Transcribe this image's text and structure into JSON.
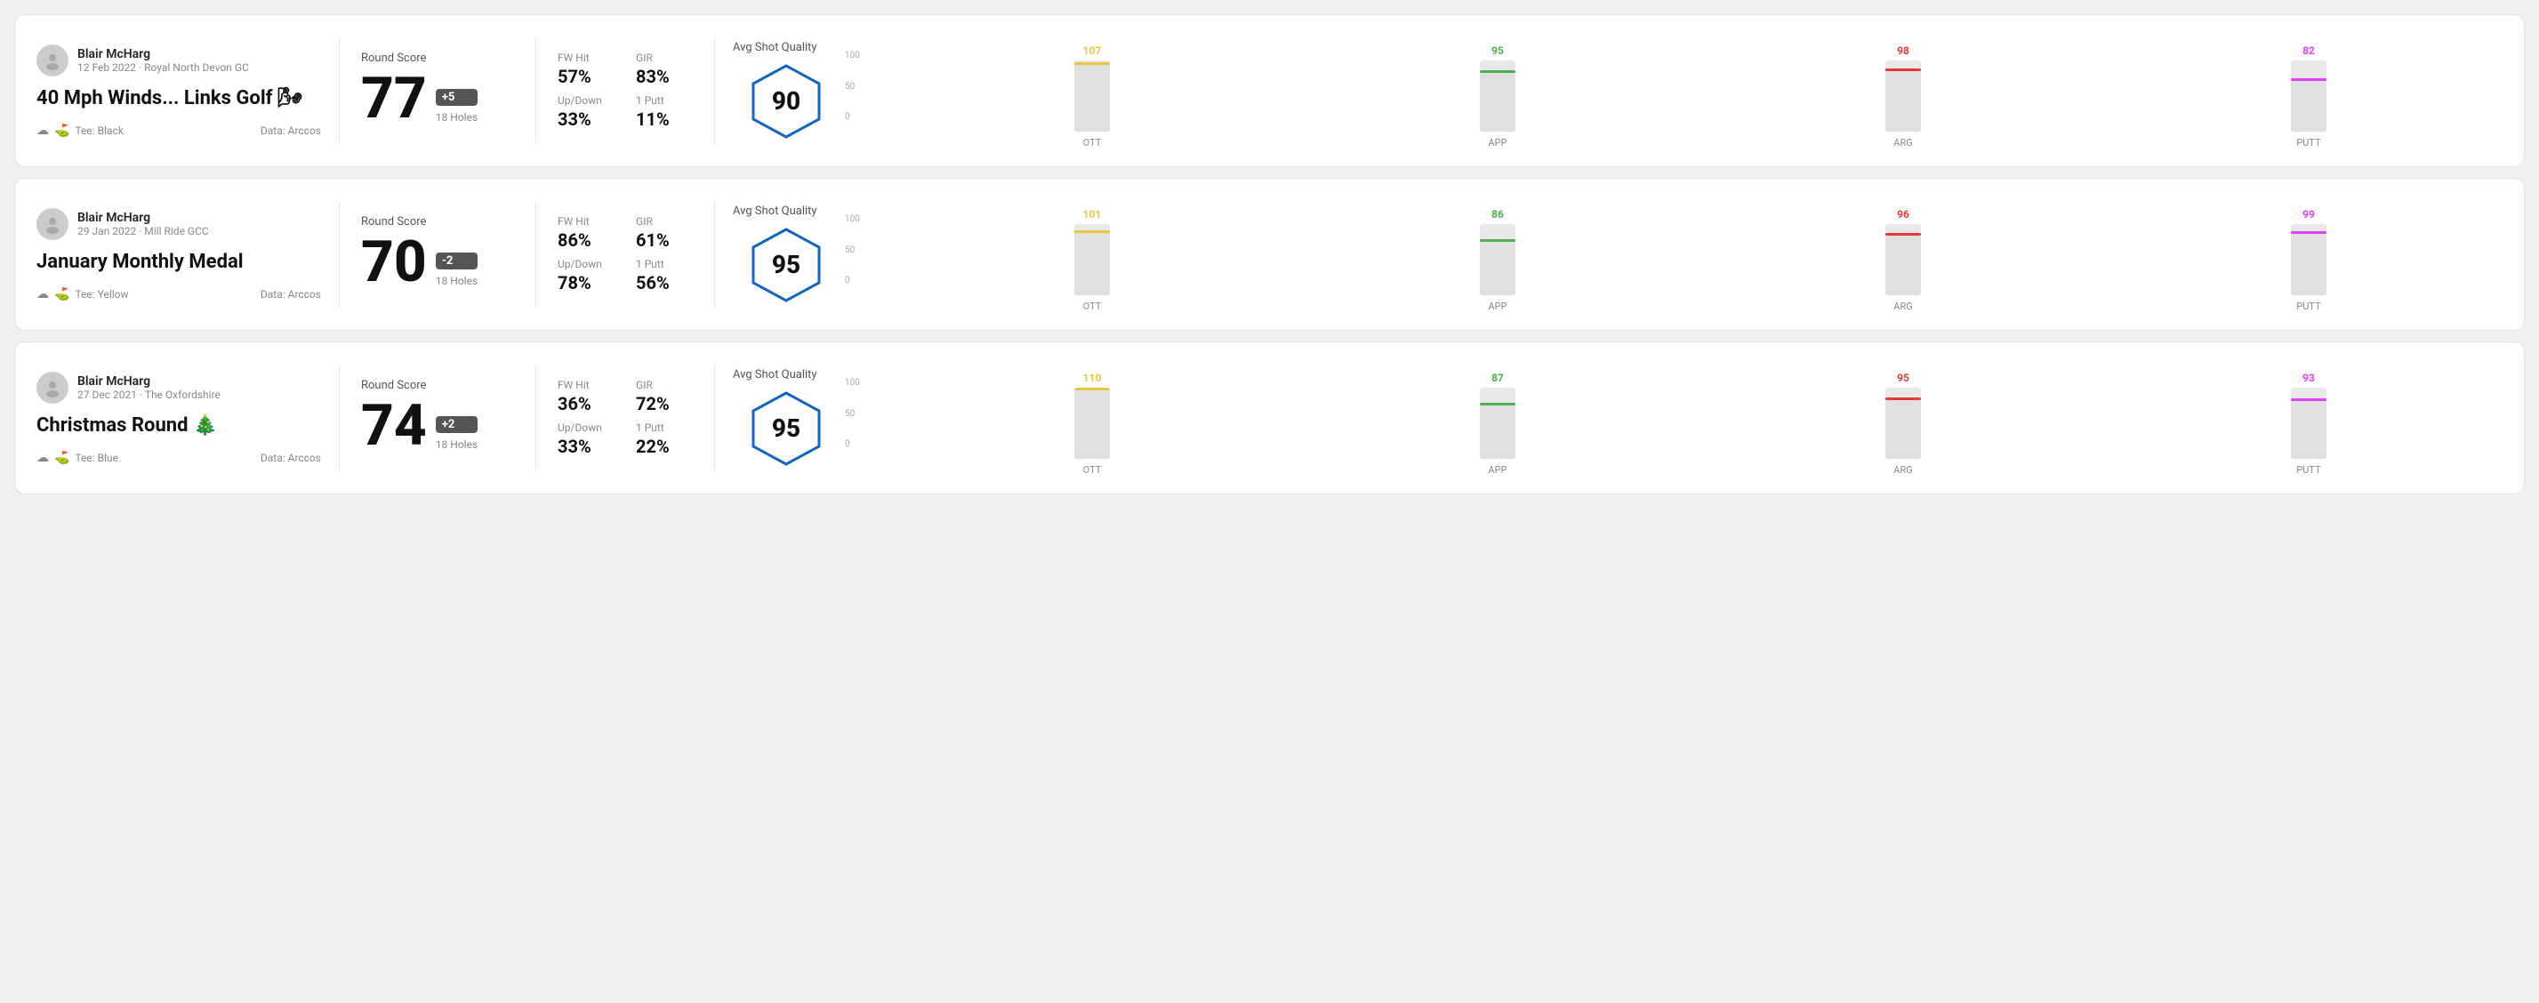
{
  "rounds": [
    {
      "id": "round-1",
      "user": {
        "name": "Blair McHarg",
        "date": "12 Feb 2022 · Royal North Devon GC"
      },
      "title": "40 Mph Winds... Links Golf 🌬",
      "tee": "Black",
      "data_source": "Data: Arccos",
      "round_score_label": "Round Score",
      "score": "77",
      "score_modifier": "+5",
      "holes": "18 Holes",
      "stats": {
        "fw_hit_label": "FW Hit",
        "fw_hit_value": "57%",
        "gir_label": "GIR",
        "gir_value": "83%",
        "updown_label": "Up/Down",
        "updown_value": "33%",
        "one_putt_label": "1 Putt",
        "one_putt_value": "11%"
      },
      "quality_label": "Avg Shot Quality",
      "quality_score": "90",
      "chart": {
        "bars": [
          {
            "label": "OTT",
            "value": 107,
            "color": "#e8c840"
          },
          {
            "label": "APP",
            "value": 95,
            "color": "#4caf50"
          },
          {
            "label": "ARG",
            "value": 98,
            "color": "#e53935"
          },
          {
            "label": "PUTT",
            "value": 82,
            "color": "#e040fb"
          }
        ],
        "max": 110,
        "y_labels": [
          "100",
          "50",
          "0"
        ]
      }
    },
    {
      "id": "round-2",
      "user": {
        "name": "Blair McHarg",
        "date": "29 Jan 2022 · Mill Ride GCC"
      },
      "title": "January Monthly Medal",
      "tee": "Yellow",
      "data_source": "Data: Arccos",
      "round_score_label": "Round Score",
      "score": "70",
      "score_modifier": "-2",
      "holes": "18 Holes",
      "stats": {
        "fw_hit_label": "FW Hit",
        "fw_hit_value": "86%",
        "gir_label": "GIR",
        "gir_value": "61%",
        "updown_label": "Up/Down",
        "updown_value": "78%",
        "one_putt_label": "1 Putt",
        "one_putt_value": "56%"
      },
      "quality_label": "Avg Shot Quality",
      "quality_score": "95",
      "chart": {
        "bars": [
          {
            "label": "OTT",
            "value": 101,
            "color": "#e8c840"
          },
          {
            "label": "APP",
            "value": 86,
            "color": "#4caf50"
          },
          {
            "label": "ARG",
            "value": 96,
            "color": "#e53935"
          },
          {
            "label": "PUTT",
            "value": 99,
            "color": "#e040fb"
          }
        ],
        "max": 110,
        "y_labels": [
          "100",
          "50",
          "0"
        ]
      }
    },
    {
      "id": "round-3",
      "user": {
        "name": "Blair McHarg",
        "date": "27 Dec 2021 · The Oxfordshire"
      },
      "title": "Christmas Round 🎄",
      "tee": "Blue",
      "data_source": "Data: Arccos",
      "round_score_label": "Round Score",
      "score": "74",
      "score_modifier": "+2",
      "holes": "18 Holes",
      "stats": {
        "fw_hit_label": "FW Hit",
        "fw_hit_value": "36%",
        "gir_label": "GIR",
        "gir_value": "72%",
        "updown_label": "Up/Down",
        "updown_value": "33%",
        "one_putt_label": "1 Putt",
        "one_putt_value": "22%"
      },
      "quality_label": "Avg Shot Quality",
      "quality_score": "95",
      "chart": {
        "bars": [
          {
            "label": "OTT",
            "value": 110,
            "color": "#e8c840"
          },
          {
            "label": "APP",
            "value": 87,
            "color": "#4caf50"
          },
          {
            "label": "ARG",
            "value": 95,
            "color": "#e53935"
          },
          {
            "label": "PUTT",
            "value": 93,
            "color": "#e040fb"
          }
        ],
        "max": 110,
        "y_labels": [
          "100",
          "50",
          "0"
        ]
      }
    }
  ]
}
